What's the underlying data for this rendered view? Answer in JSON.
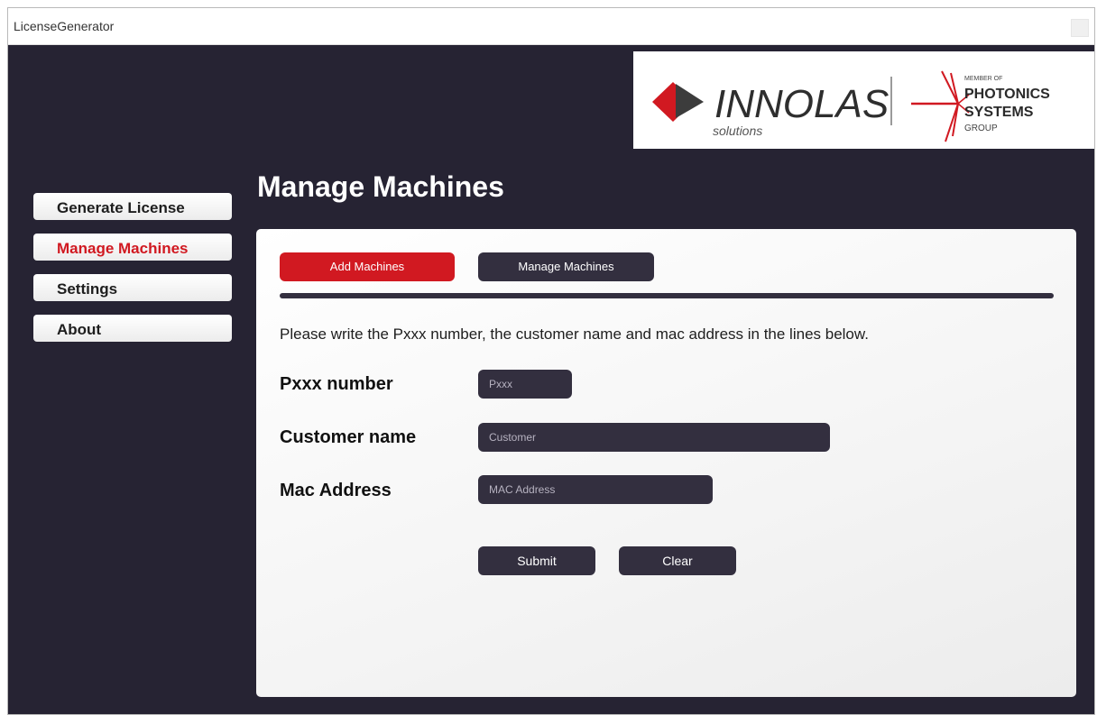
{
  "window": {
    "title": "LicenseGenerator"
  },
  "branding": {
    "innolas_name": "INNOLAS",
    "innolas_tagline": "solutions",
    "partner_line1": "MEMBER OF",
    "partner_line2": "PHOTONICS",
    "partner_line3": "SYSTEMS",
    "partner_line4": "GROUP",
    "brand_red": "#d11921"
  },
  "sidebar": {
    "items": [
      {
        "label": "Generate License",
        "active": false
      },
      {
        "label": "Manage Machines",
        "active": true
      },
      {
        "label": "Settings",
        "active": false
      },
      {
        "label": "About",
        "active": false
      }
    ]
  },
  "page": {
    "title": "Manage Machines"
  },
  "tabs": {
    "add_label": "Add Machines",
    "manage_label": "Manage Machines",
    "active": "Add Machines"
  },
  "form": {
    "instructions": "Please write the Pxxx number, the customer name and mac address in the lines below.",
    "pxxx_label": "Pxxx number",
    "pxxx_placeholder": "Pxxx",
    "pxxx_value": "",
    "customer_label": "Customer name",
    "customer_placeholder": "Customer",
    "customer_value": "",
    "mac_label": "Mac Address",
    "mac_placeholder": "MAC Address",
    "mac_value": "",
    "submit_label": "Submit",
    "clear_label": "Clear"
  },
  "colors": {
    "background": "#262333",
    "control_dark": "#332f3f",
    "accent_red": "#d11921"
  }
}
